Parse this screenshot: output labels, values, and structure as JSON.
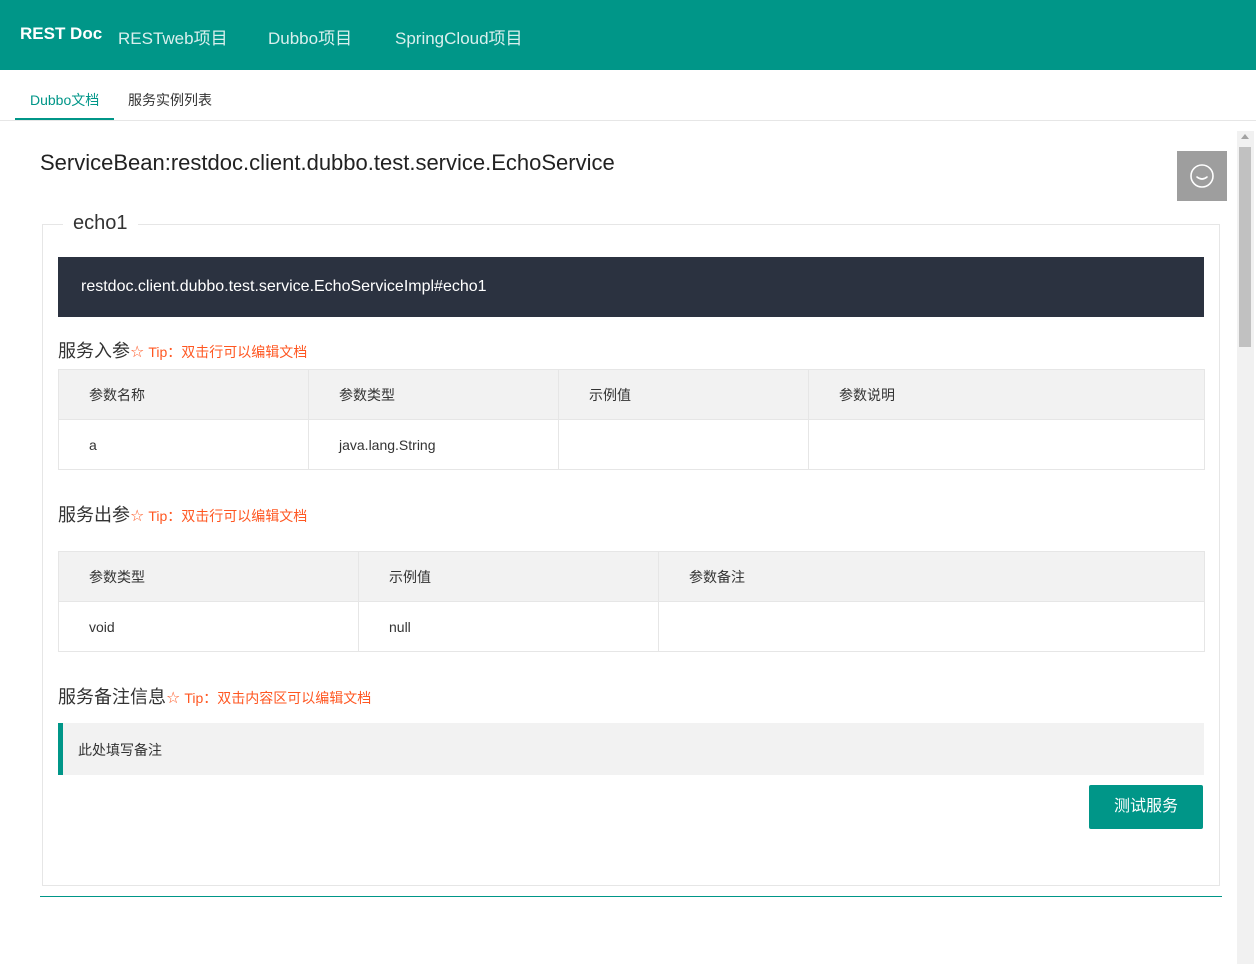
{
  "header": {
    "brand": "REST Doc",
    "nav": [
      "RESTweb项目",
      "Dubbo项目",
      "SpringCloud项目"
    ]
  },
  "tabs": [
    "Dubbo文档",
    "服务实例列表"
  ],
  "page": {
    "title": "ServiceBean:restdoc.client.dubbo.test.service.EchoService"
  },
  "method": {
    "legend": "echo1",
    "signature": "restdoc.client.dubbo.test.service.EchoServiceImpl#echo1"
  },
  "input_params": {
    "title": "服务入参",
    "tip": "Tip：双击行可以编辑文档",
    "headers": [
      "参数名称",
      "参数类型",
      "示例值",
      "参数说明"
    ],
    "rows": [
      [
        "a",
        "java.lang.String",
        "",
        ""
      ]
    ]
  },
  "output_params": {
    "title": "服务出参",
    "tip": "Tip：双击行可以编辑文档",
    "headers": [
      "参数类型",
      "示例值",
      "参数备注"
    ],
    "rows": [
      [
        "void",
        "null",
        ""
      ]
    ]
  },
  "remark": {
    "title": "服务备注信息",
    "tip": "Tip：双击内容区可以编辑文档",
    "content": "此处填写备注"
  },
  "actions": {
    "test_label": "测试服务"
  },
  "icons": {
    "star": "☆",
    "chat": "chat-icon"
  },
  "colors": {
    "primary": "#009688",
    "method_bar": "#2b3240",
    "tip": "#ff5722"
  }
}
